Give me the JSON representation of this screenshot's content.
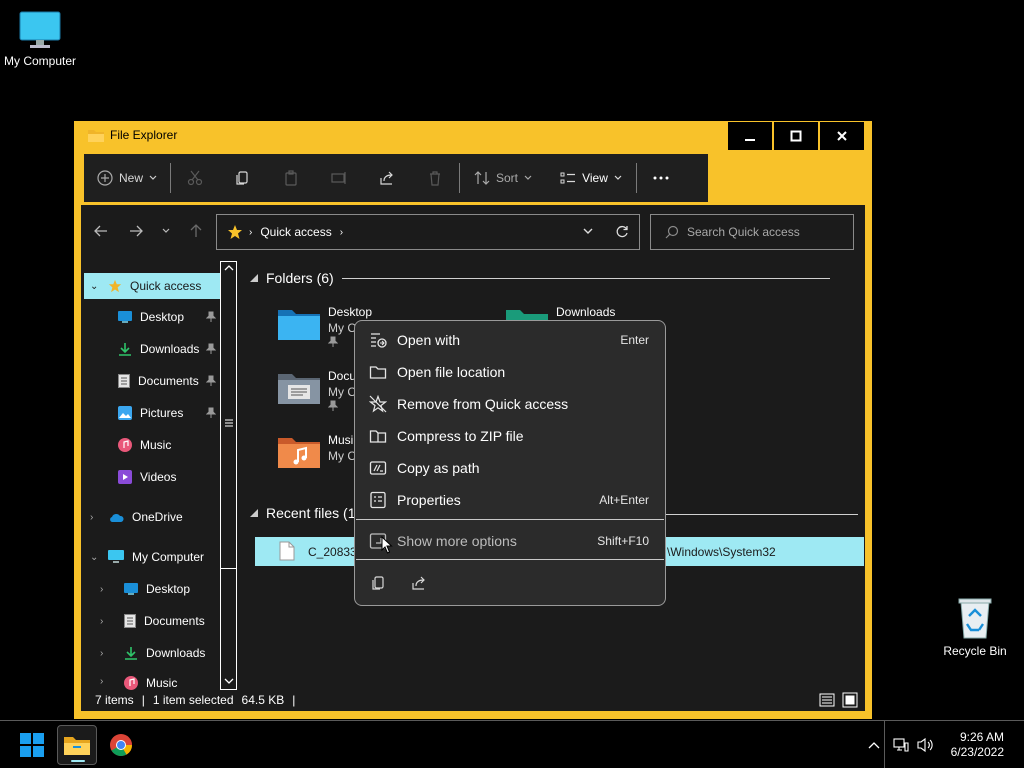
{
  "desktop": {
    "my_computer_label": "My Computer",
    "recycle_bin_label": "Recycle Bin"
  },
  "window": {
    "title": "File Explorer"
  },
  "toolbar": {
    "new_label": "New",
    "sort_label": "Sort",
    "view_label": "View"
  },
  "address": {
    "crumb": "Quick access",
    "search_placeholder": "Search Quick access"
  },
  "nav": {
    "quick_access": "Quick access",
    "qa_items": [
      "Desktop",
      "Downloads",
      "Documents",
      "Pictures",
      "Music",
      "Videos"
    ],
    "onedrive": "OneDrive",
    "my_computer": "My Computer",
    "mc_items": [
      "Desktop",
      "Documents",
      "Downloads",
      "Music"
    ]
  },
  "main": {
    "folders_header": "Folders (6)",
    "folders": [
      {
        "name": "Desktop",
        "sub": "My C"
      },
      {
        "name": "Downloads",
        "sub": ""
      },
      {
        "name": "Docu",
        "sub": "My C"
      },
      {
        "name": "Musi",
        "sub": "My C"
      }
    ],
    "recent_header": "Recent files (1",
    "recent_file_name": "C_20833.",
    "recent_file_path": "\\Windows\\System32"
  },
  "status": {
    "items": "7 items",
    "selected": "1 item selected",
    "size": "64.5 KB"
  },
  "context_menu": {
    "items": [
      {
        "label": "Open with",
        "shortcut": "Enter",
        "icon": "open-with-icon"
      },
      {
        "label": "Open file location",
        "shortcut": "",
        "icon": "folder-icon"
      },
      {
        "label": "Remove from Quick access",
        "shortcut": "",
        "icon": "star-off-icon"
      },
      {
        "label": "Compress to ZIP file",
        "shortcut": "",
        "icon": "zip-icon"
      },
      {
        "label": "Copy as path",
        "shortcut": "",
        "icon": "path-icon"
      },
      {
        "label": "Properties",
        "shortcut": "Alt+Enter",
        "icon": "properties-icon"
      }
    ],
    "more": {
      "label": "Show more options",
      "shortcut": "Shift+F10"
    }
  },
  "taskbar": {
    "time": "9:26 AM",
    "date": "6/23/2022"
  },
  "colors": {
    "window_border": "#f8c22a",
    "selection": "#9ee9f3",
    "accent_blue": "#1a8fd8"
  }
}
